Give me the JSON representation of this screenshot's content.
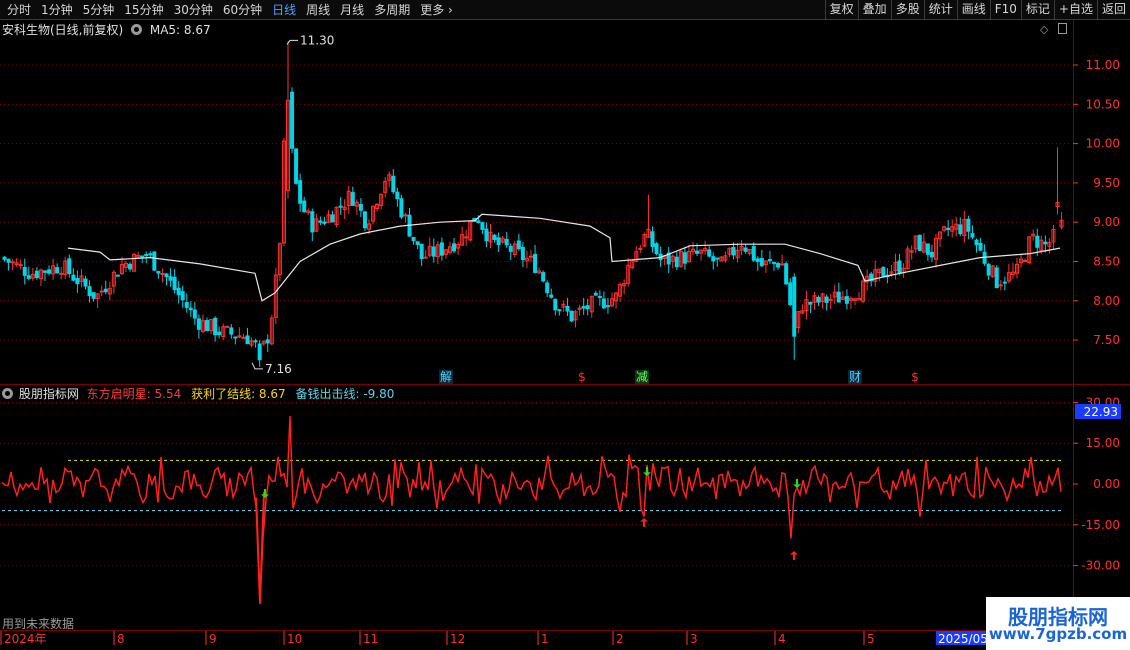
{
  "toolbar": {
    "periods": [
      "分时",
      "1分钟",
      "5分钟",
      "15分钟",
      "30分钟",
      "60分钟",
      "日线",
      "周线",
      "月线",
      "多周期",
      "更多"
    ],
    "active_period": "日线",
    "more_chevron": "chevron-right-icon",
    "buttons": [
      "复权",
      "叠加",
      "多股",
      "统计",
      "画线",
      "F10",
      "标记",
      "+自选",
      "返回"
    ]
  },
  "price_panel": {
    "title": "安科生物(日线,前复权)",
    "ma_label": "MA5: 8.67",
    "max_label": "11.30",
    "min_label": "7.16",
    "axis_ticks": [
      "11.00",
      "10.50",
      "10.00",
      "9.50",
      "9.00",
      "8.50",
      "8.00",
      "7.50"
    ],
    "event_markers": [
      "解",
      "$",
      "减",
      "财",
      "$"
    ],
    "tool_icons": [
      "diamond-icon",
      "panel-toggle-icon"
    ]
  },
  "indicator_panel": {
    "name": "股朋指标网",
    "series_1": "东方启明星: 5.54",
    "series_2": "获利了结线: 8.67",
    "series_3": "备钱出击线: -9.80",
    "axis_ticks": [
      "30.00",
      "15.00",
      "0.00",
      "-15.00",
      "-30.00"
    ],
    "current_value": "22.93",
    "future_note": "用到未来数据"
  },
  "time_axis": {
    "labels": [
      "2024年",
      "8",
      "9",
      "10",
      "11",
      "12",
      "1",
      "2",
      "3",
      "4",
      "5"
    ],
    "end_label": "2025/05"
  },
  "watermark": {
    "line1": "股朋指标网",
    "line2": "www.7gpzb.com"
  },
  "colors": {
    "up": "#ff3030",
    "down": "#00d4e6",
    "ma": "#e6e6e6",
    "grid": "#7a0000",
    "indicator": "#ff2020",
    "profit_line": "#e6e600",
    "cash_line": "#80e0ff",
    "buy_arrow": "#ff2020",
    "sell_arrow": "#19e619",
    "daily_tab": "#4fa0ff",
    "axis_text": "#ff3030",
    "ind_value_box": "#1a3cff"
  },
  "chart_data": [
    {
      "type": "candlestick",
      "title": "安科生物(日线,前复权)",
      "series": [
        {
          "name": "MA5",
          "last_value": 8.67
        }
      ],
      "ylim": [
        7.16,
        11.3
      ],
      "x": [
        "2024-07",
        "2024-08",
        "2024-09",
        "2024-10",
        "2024-11",
        "2024-12",
        "2025-01",
        "2025-02",
        "2025-03",
        "2025-04",
        "2025-05"
      ],
      "close_approx": [
        8.6,
        8.2,
        7.3,
        10.2,
        9.2,
        8.6,
        8.0,
        8.5,
        8.4,
        8.1,
        9.0
      ],
      "max": 11.3,
      "min": 7.16
    },
    {
      "type": "line",
      "series": [
        {
          "name": "东方启明星",
          "last_value": 5.54
        },
        {
          "name": "获利了结线",
          "last_value": 8.67
        },
        {
          "name": "备钱出击线",
          "last_value": -9.8
        }
      ],
      "ylim": [
        -30,
        30
      ],
      "current_value": 22.93
    }
  ]
}
